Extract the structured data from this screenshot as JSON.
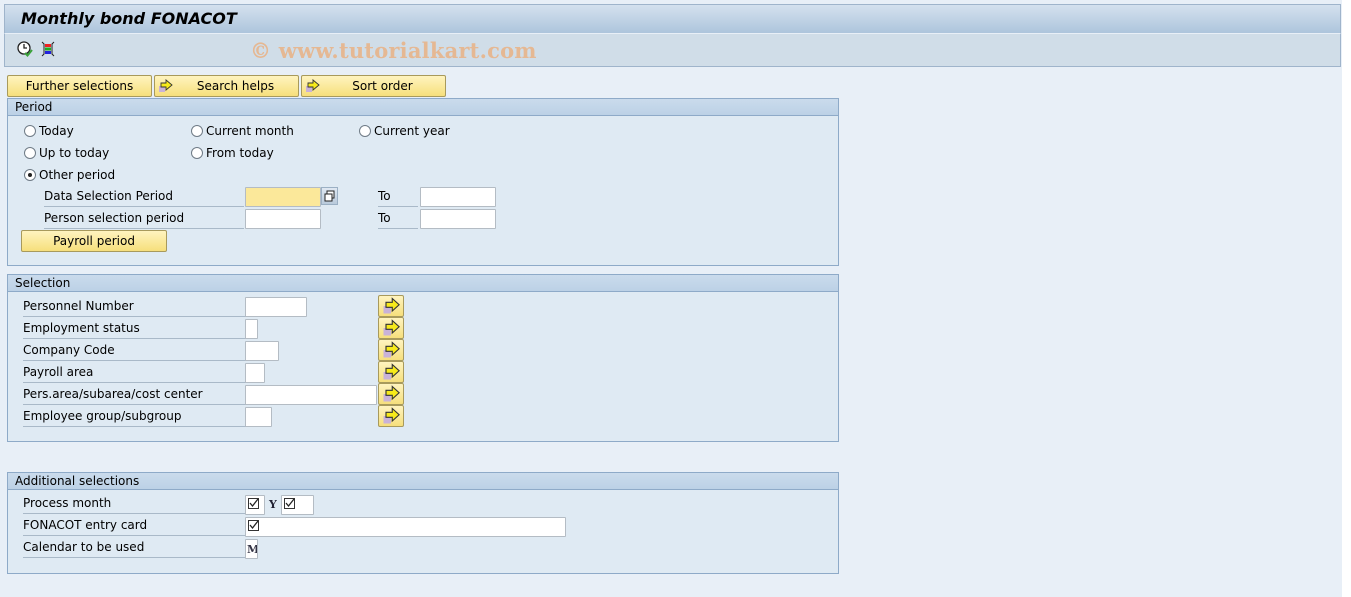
{
  "window": {
    "title": "Monthly bond FONACOT",
    "watermark": "© www.tutorialkart.com"
  },
  "toolbar": {
    "icons": [
      {
        "name": "execute-clock-icon",
        "label": "Execute"
      },
      {
        "name": "selection-screen-icon",
        "label": "Selection screen"
      }
    ]
  },
  "tabs": {
    "further_selections": "Further selections",
    "search_helps": "Search helps",
    "sort_order": "Sort order"
  },
  "period": {
    "title": "Period",
    "radios": {
      "today": "Today",
      "current_month": "Current month",
      "current_year": "Current year",
      "up_to_today": "Up to today",
      "from_today": "From today",
      "other_period": "Other period"
    },
    "selected": "other_period",
    "data_selection_label": "Data Selection Period",
    "data_selection_from": "",
    "data_selection_to": "",
    "person_selection_label": "Person selection period",
    "person_selection_from": "",
    "person_selection_to": "",
    "to_label": "To",
    "payroll_button": "Payroll period"
  },
  "selection": {
    "title": "Selection",
    "fields": [
      {
        "label": "Personnel Number",
        "value": ""
      },
      {
        "label": "Employment status",
        "value": ""
      },
      {
        "label": "Company Code",
        "value": ""
      },
      {
        "label": "Payroll area",
        "value": ""
      },
      {
        "label": "Pers.area/subarea/cost center",
        "value": ""
      },
      {
        "label": "Employee group/subgroup",
        "value": ""
      }
    ]
  },
  "additional": {
    "title": "Additional selections",
    "process_month_label": "Process month",
    "process_month_sep": "Y",
    "fonacot_label": "FONACOT entry card",
    "calendar_label": "Calendar to be used",
    "calendar_value": "M"
  }
}
